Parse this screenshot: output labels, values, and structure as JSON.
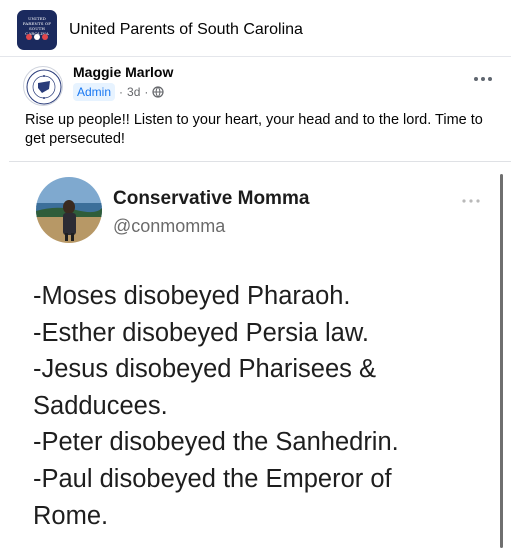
{
  "group": {
    "name": "United Parents of South Carolina",
    "logo_text": "UNITED PARENTS OF SOUTH CAROLINA"
  },
  "post": {
    "author": "Maggie Marlow",
    "role_badge": "Admin",
    "separator": "·",
    "time": "3d",
    "separator2": "·",
    "audience_icon": "globe-icon",
    "more_icon": "more-horizontal-icon",
    "text": "Rise up people!!  Listen to your heart, your head and to the lord.  Time to get persecuted!"
  },
  "tweet": {
    "name": "Conservative Momma",
    "handle": "@conmomma",
    "more_icon": "more-horizontal-icon",
    "lines": [
      "-Moses disobeyed Pharaoh.",
      "-Esther disobeyed Persia law.",
      "-Jesus disobeyed Pharisees &",
      "Sadducees.",
      "-Peter disobeyed the Sanhedrin.",
      "-Paul disobeyed the Emperor of",
      "Rome."
    ]
  },
  "colors": {
    "accent": "#1877f2",
    "badge_bg": "#e7f3ff",
    "meta_text": "#65676b",
    "logo_bg": "#1b2a5e"
  }
}
